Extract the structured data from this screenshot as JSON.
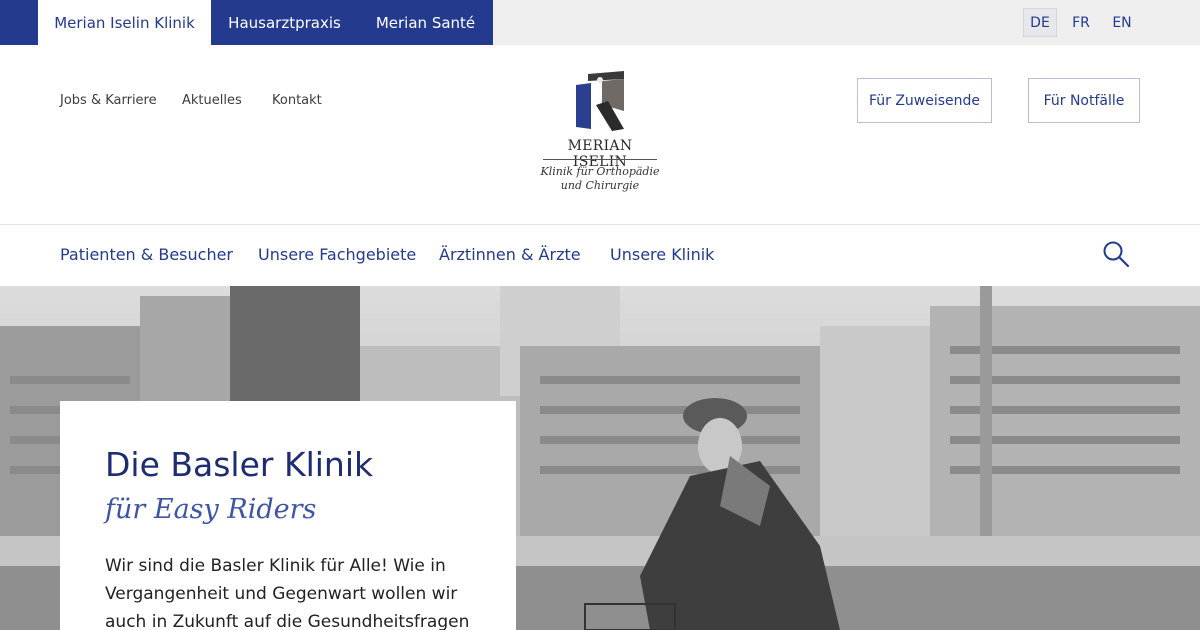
{
  "topbar": {
    "sites": [
      "Merian Iselin Klinik",
      "Hausarztpraxis",
      "Merian Santé"
    ],
    "languages": [
      "DE",
      "FR",
      "EN"
    ],
    "active_language": "DE"
  },
  "header": {
    "util_links": [
      "Jobs & Karriere",
      "Aktuelles",
      "Kontakt"
    ],
    "logo": {
      "name": "MERIAN ISELIN",
      "subtitle_line1": "Klinik für Orthopädie",
      "subtitle_line2": "und Chirurgie"
    },
    "cta": [
      "Für Zuweisende",
      "Für Notfälle"
    ]
  },
  "mainnav": {
    "items": [
      "Patienten & Besucher",
      "Unsere Fachgebiete",
      "Ärztinnen & Ärzte",
      "Unsere Klinik"
    ]
  },
  "hero": {
    "title": "Die Basler Klinik",
    "subtitle": "für Easy Riders",
    "text": "Wir sind die Basler Klinik für Alle! Wie in Vergangenheit und Gegenwart wollen wir auch in Zukunft auf die Gesundheitsfragen"
  },
  "colors": {
    "brand_blue": "#233a8f",
    "topbar_bg": "#efefef"
  },
  "icons": {
    "search": "search-icon"
  }
}
